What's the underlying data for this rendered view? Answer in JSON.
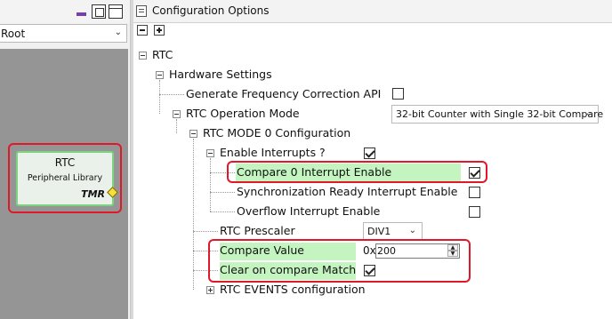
{
  "left_panel": {
    "root_dropdown_value": "Root",
    "block": {
      "title": "RTC",
      "subtitle": "Peripheral Library",
      "port": "TMR"
    }
  },
  "right_panel": {
    "title": "Configuration Options",
    "tree": {
      "rtc": "RTC",
      "hardware_settings": "Hardware Settings",
      "gen_freq_correction": "Generate Frequency Correction API",
      "operation_mode_label": "RTC Operation Mode",
      "operation_mode_value": "32-bit Counter with Single 32-bit Compare",
      "mode0_config": "RTC MODE 0 Configuration",
      "enable_interrupts": "Enable Interrupts ?",
      "compare0_interrupt": "Compare 0 Interrupt Enable",
      "sync_ready_interrupt": "Synchronization Ready Interrupt Enable",
      "overflow_interrupt": "Overflow Interrupt Enable",
      "prescaler_label": "RTC Prescaler",
      "prescaler_value": "DIV1",
      "compare_value_label": "Compare Value",
      "compare_value_prefix": "0x",
      "compare_value": "200",
      "clear_on_match": "Clear on compare Match",
      "events_config": "RTC EVENTS configuration"
    },
    "checkboxes": {
      "gen_freq_correction": false,
      "enable_interrupts": true,
      "compare0_interrupt": true,
      "sync_ready_interrupt": false,
      "overflow_interrupt": false,
      "clear_on_match": true
    }
  },
  "colors": {
    "highlight": "#c4f5c1",
    "annotation_outline": "#e0182a",
    "block_border": "#7ed37e",
    "canvas_background": "#959595"
  }
}
